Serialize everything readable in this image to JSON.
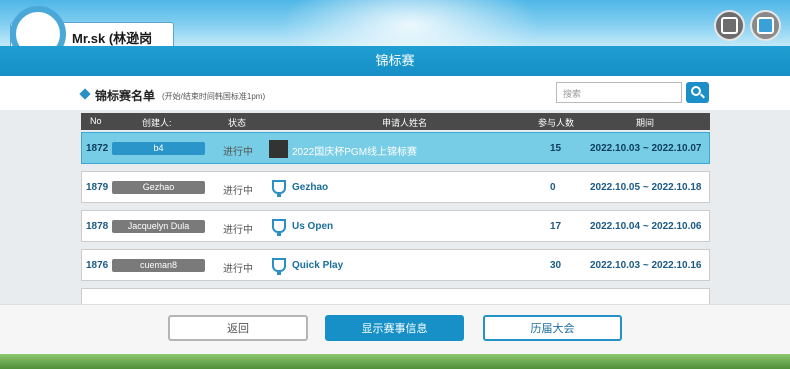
{
  "user": {
    "name": "Mr.sk (林逊岗"
  },
  "header": {
    "title": "锦标赛"
  },
  "list": {
    "title": "锦标赛名单",
    "note": "(开始/结束时间韩国标准1pm)",
    "search_placeholder": "搜索"
  },
  "table": {
    "columns": [
      "No",
      "创建人:",
      "状态",
      "申请人姓名",
      "参与人数",
      "期间"
    ],
    "rows": [
      {
        "no": "1872",
        "creator": "b4",
        "status": "进行中",
        "name": "2022国庆杯PGM线上锦标赛",
        "count": "15",
        "period": "2022.10.03 ~ 2022.10.07",
        "icon": "thumbnail"
      },
      {
        "no": "1879",
        "creator": "Gezhao",
        "status": "进行中",
        "name": "Gezhao",
        "count": "0",
        "period": "2022.10.05 ~ 2022.10.18",
        "icon": "trophy-icon"
      },
      {
        "no": "1878",
        "creator": "Jacquelyn Dula",
        "status": "进行中",
        "name": "Us Open",
        "count": "17",
        "period": "2022.10.04 ~ 2022.10.06",
        "icon": "trophy-icon"
      },
      {
        "no": "1876",
        "creator": "cueman8",
        "status": "进行中",
        "name": "Quick Play",
        "count": "30",
        "period": "2022.10.03 ~ 2022.10.16",
        "icon": "trophy-icon"
      }
    ]
  },
  "buttons": {
    "back": "返回",
    "info": "显示赛事信息",
    "history": "历届大会"
  },
  "colors": {
    "accent": "#1690c7",
    "selected_row": "#78cde6"
  }
}
